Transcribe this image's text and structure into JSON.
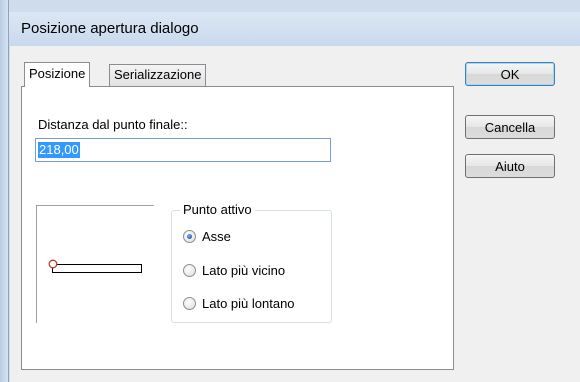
{
  "window": {
    "title": "Posizione apertura dialogo"
  },
  "tabs": [
    {
      "label": "Posizione",
      "active": true
    },
    {
      "label": "Serializzazione",
      "active": false
    }
  ],
  "distance": {
    "label": "Distanza dal punto finale::",
    "value": "218,00"
  },
  "active_point": {
    "title": "Punto attivo",
    "options": [
      {
        "label": "Asse",
        "checked": true
      },
      {
        "label": "Lato più vicino",
        "checked": false
      },
      {
        "label": "Lato più lontano",
        "checked": false
      }
    ]
  },
  "buttons": {
    "ok": "OK",
    "cancel": "Cancella",
    "help": "Aiuto"
  },
  "colors": {
    "selection": "#3399ff",
    "marker": "#c0392b",
    "title_bar": "#c6d7ec"
  }
}
